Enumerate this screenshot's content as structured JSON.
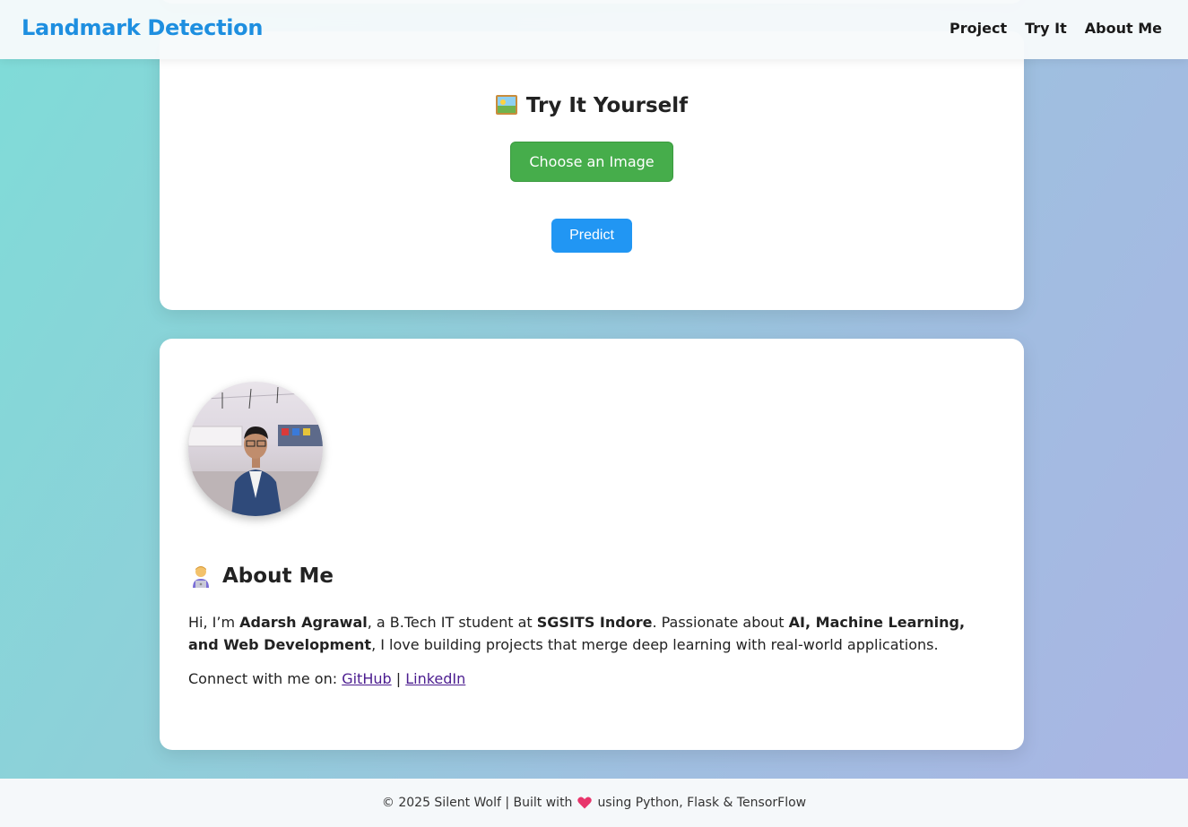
{
  "header": {
    "brand": "Landmark Detection",
    "nav": [
      "Project",
      "Try It",
      "About Me"
    ]
  },
  "try_section": {
    "title": "Try It Yourself",
    "title_icon": "framed-picture-icon",
    "choose_label": "Choose an Image",
    "predict_label": "Predict"
  },
  "about_section": {
    "title": "About Me",
    "title_icon": "technologist-icon",
    "avatar_icon": "profile-photo",
    "intro_1": "Hi, I’m ",
    "name": "Adarsh Agrawal",
    "intro_2": ", a B.Tech IT student at ",
    "college": "SGSITS Indore",
    "intro_3": ". Passionate about ",
    "interests": "AI, Machine Learning, and Web Development",
    "intro_4": ", I love building projects that merge deep learning with real-world applications.",
    "connect_label": "Connect with me on: ",
    "links": [
      "GitHub",
      "LinkedIn"
    ],
    "separator": " | "
  },
  "footer": {
    "text_before": "© 2025 Silent Wolf | Built with",
    "text_after": "using Python, Flask & TensorFlow",
    "heart_icon": "heart-icon"
  },
  "colors": {
    "brand": "#1e8fe0",
    "choose_button": "#46ad4b",
    "predict_button": "#2196f3",
    "link": "#4b1c8f",
    "heart": "#e8356b"
  }
}
